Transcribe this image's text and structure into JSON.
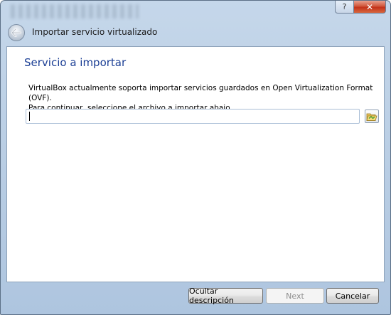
{
  "window": {
    "title": "Importar servicio virtualizado",
    "help_label": "?",
    "close_label": "✕"
  },
  "page": {
    "heading": "Servicio a importar",
    "description_line1": "VirtualBox actualmente soporta importar servicios guardados en Open Virtualization Format (OVF).",
    "description_line2": "Para continuar, seleccione el archivo a importar abajo."
  },
  "file_input": {
    "value": ""
  },
  "footer": {
    "hide_description_label": "Ocultar descripción",
    "next_label": "Next",
    "cancel_label": "Cancelar"
  },
  "icons": {
    "back": "back-arrow-icon",
    "folder": "open-folder-icon",
    "help": "help-icon",
    "close": "close-icon"
  }
}
